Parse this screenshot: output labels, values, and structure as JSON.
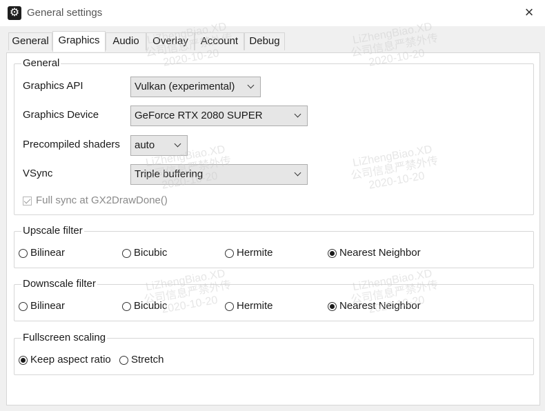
{
  "window": {
    "title": "General settings",
    "app_icon": "gear-icon",
    "close_glyph": "×"
  },
  "tabs": [
    {
      "label": "General"
    },
    {
      "label": "Graphics",
      "active": true
    },
    {
      "label": "Audio"
    },
    {
      "label": "Overlay"
    },
    {
      "label": "Account"
    },
    {
      "label": "Debug"
    }
  ],
  "general_group": {
    "legend": "General",
    "graphics_api": {
      "label": "Graphics API",
      "value": "Vulkan (experimental)"
    },
    "graphics_device": {
      "label": "Graphics Device",
      "value": "GeForce RTX 2080 SUPER"
    },
    "precompiled_shaders": {
      "label": "Precompiled shaders",
      "value": "auto"
    },
    "vsync": {
      "label": "VSync",
      "value": "Triple buffering"
    },
    "full_sync": {
      "label": "Full sync at GX2DrawDone()",
      "checked": true,
      "disabled": true
    }
  },
  "upscale_group": {
    "legend": "Upscale filter",
    "options": [
      {
        "label": "Bilinear",
        "checked": false
      },
      {
        "label": "Bicubic",
        "checked": false
      },
      {
        "label": "Hermite",
        "checked": false
      },
      {
        "label": "Nearest Neighbor",
        "checked": true
      }
    ]
  },
  "downscale_group": {
    "legend": "Downscale filter",
    "options": [
      {
        "label": "Bilinear",
        "checked": false
      },
      {
        "label": "Bicubic",
        "checked": false
      },
      {
        "label": "Hermite",
        "checked": false
      },
      {
        "label": "Nearest Neighbor",
        "checked": true
      }
    ]
  },
  "fullscreen_group": {
    "legend": "Fullscreen scaling",
    "options": [
      {
        "label": "Keep aspect ratio",
        "checked": true
      },
      {
        "label": "Stretch",
        "checked": false
      }
    ]
  },
  "watermark": {
    "line1": "LiZhengBiao.XD",
    "line2": "公司信息严禁外传",
    "line3": "2020-10-20"
  }
}
